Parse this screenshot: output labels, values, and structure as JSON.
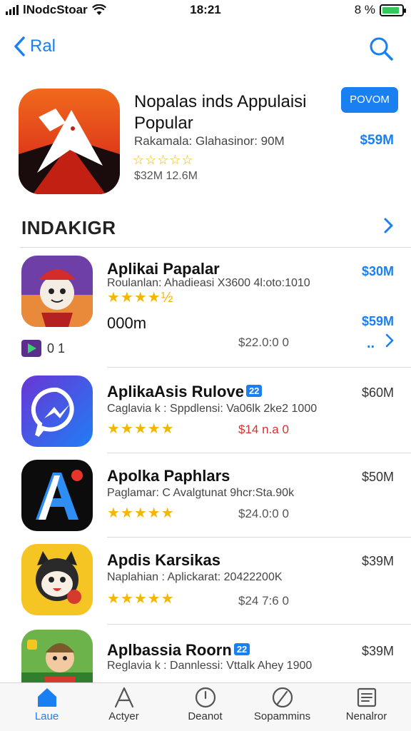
{
  "status_bar": {
    "carrier": "lNodcStoar",
    "time": "18:21",
    "battery_text": "8 %",
    "battery_level": 0.9
  },
  "nav": {
    "back_label": "Ral"
  },
  "featured": {
    "title": "Nopalas inds Appulaisi Popular",
    "button_label": "POVOM",
    "meta": "Rakamala: Glahasinor: 90M",
    "price": "$59M",
    "stars": "☆☆☆☆☆",
    "size": "$32M 12.6M"
  },
  "section": {
    "title": "INDAKIGR"
  },
  "apps": [
    {
      "name": "Aplikai Papalar",
      "subtitle": "Roulanlan: Ahadieasi X3600 4l:oto:1010",
      "stars": "★★★★½",
      "price": "$30M",
      "extra_label": "000m",
      "extra_price": "$59M",
      "extra_dots": "..",
      "sub_price": "$22.0:0 0",
      "sub_badge_count": "0 1"
    },
    {
      "name": "AplikaAsis Rulove",
      "badge": "22",
      "subtitle": "Caglavia k : Sppdlensi: Va06lk 2ke2 1000",
      "stars": "★★★★★",
      "price": "$60M",
      "sub_price": "$14 n.a 0"
    },
    {
      "name": "Apolka Paphlars",
      "subtitle": "Paglamar: C Avalgtunat 9hcr:Sta.90k",
      "stars": "★★★★★",
      "price": "$50M",
      "sub_price": "$24.0:0 0"
    },
    {
      "name": "Apdis Karsikas",
      "subtitle": "Naplahian : Aplickarat: 20422200K",
      "stars": "★★★★★",
      "price": "$39M",
      "sub_price": "$24 7:6 0"
    },
    {
      "name": "Aplbassia Roorn",
      "badge": "22",
      "subtitle": "Reglavia k : Dannlessi: Vttalk Ahey 1900",
      "stars": "",
      "price": "$39M"
    }
  ],
  "tabs": [
    {
      "label": "Laue"
    },
    {
      "label": "Actyer"
    },
    {
      "label": "Deanot"
    },
    {
      "label": "Sopammins"
    },
    {
      "label": "Nenalror"
    }
  ],
  "colors": {
    "accent": "#1a7ff0",
    "star": "#f2b700",
    "sub_price_alert": "#d83030"
  }
}
